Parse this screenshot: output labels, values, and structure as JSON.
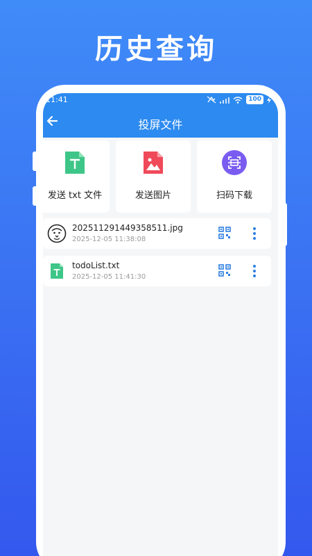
{
  "promo": {
    "title": "历史查询"
  },
  "status": {
    "time": "11:41",
    "battery": "100"
  },
  "app": {
    "title": "投屏文件"
  },
  "actions": [
    {
      "label": "发送 txt 文件",
      "icon": "txt-file-icon"
    },
    {
      "label": "发送图片",
      "icon": "image-file-icon"
    },
    {
      "label": "扫码下载",
      "icon": "scan-icon"
    }
  ],
  "files": [
    {
      "name": "20251129144935851​1.jpg",
      "date": "2025-12-05 11:38:08",
      "icon": "lion-image-icon"
    },
    {
      "name": "todoList.txt",
      "date": "2025-12-05 11:41:30",
      "icon": "txt-file-icon"
    }
  ],
  "colors": {
    "accent": "#2c8af0",
    "txt_green": "#3ec688",
    "image_red": "#f04a5a",
    "scan_purple": "#7a5cf0",
    "background_gradient_top": "#3f8cf8",
    "background_gradient_bottom": "#3358ee"
  }
}
